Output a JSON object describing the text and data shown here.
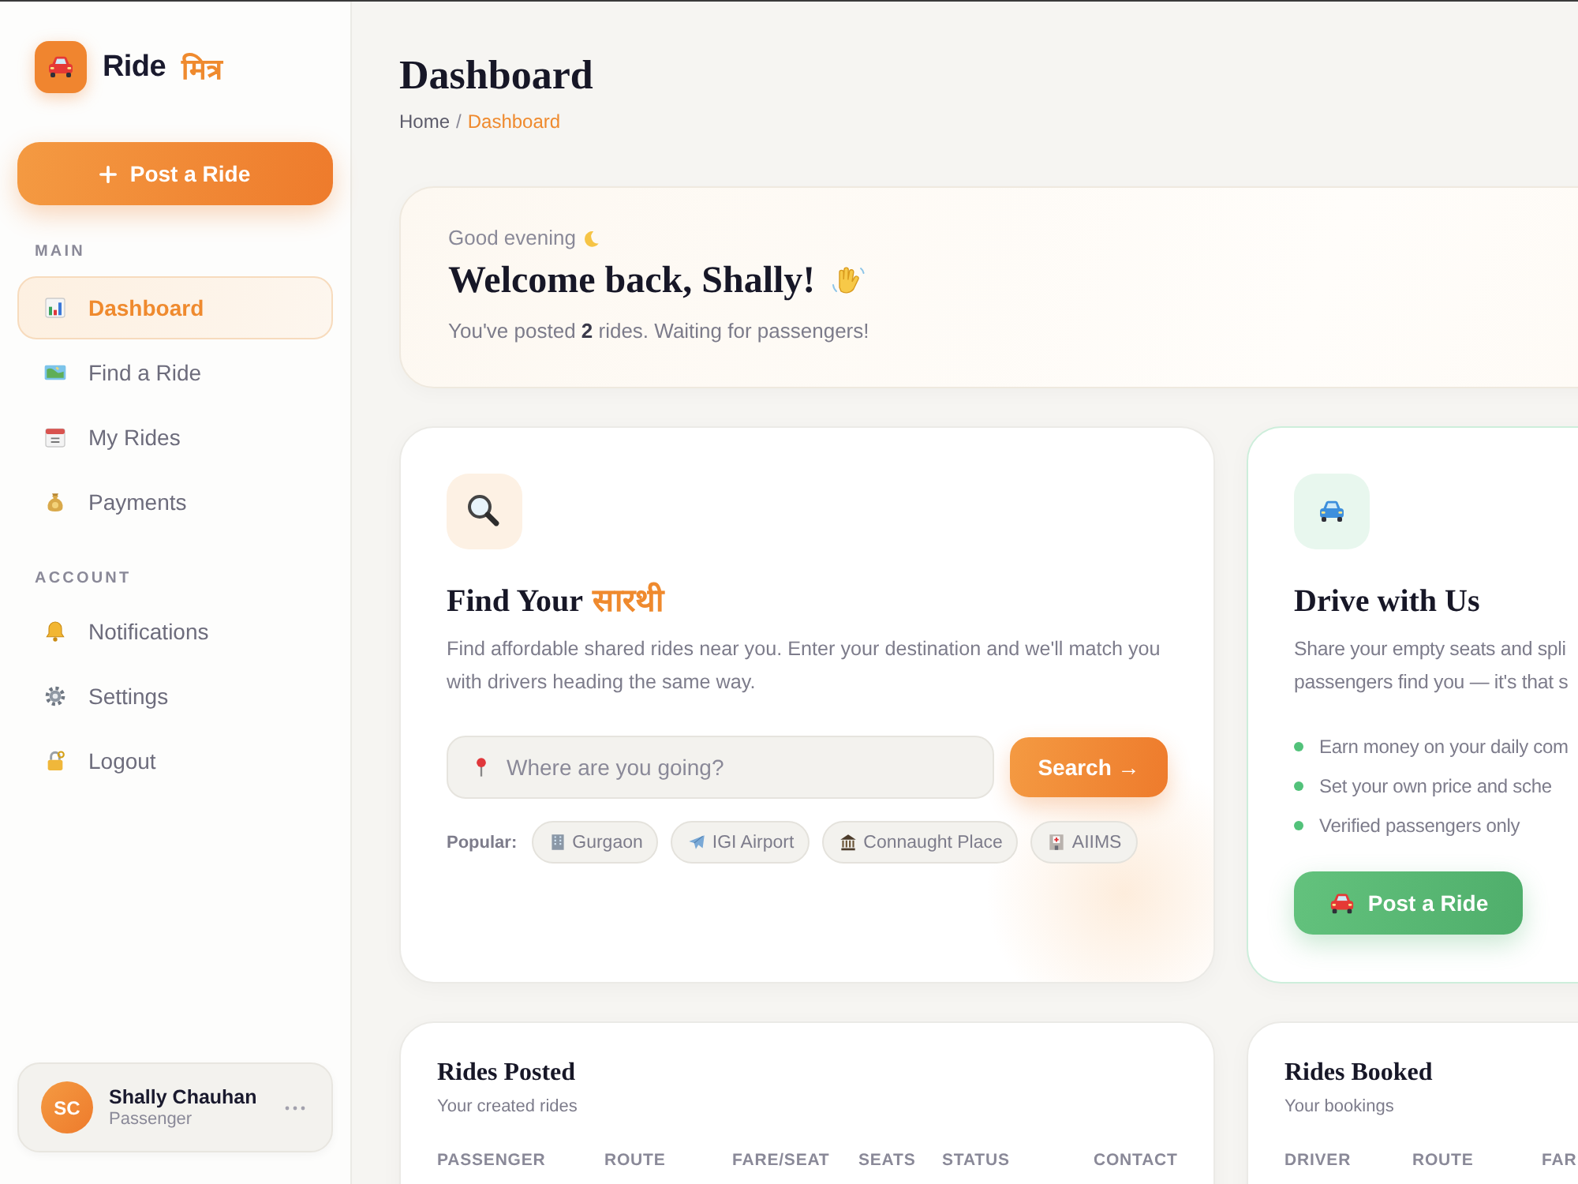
{
  "sidebar": {
    "logo": {
      "text": "Ride",
      "accent": "मित्र"
    },
    "post_button": "Post a Ride",
    "sections": [
      {
        "heading": "MAIN",
        "items": [
          {
            "label": "Dashboard",
            "selected": true
          },
          {
            "label": "Find a Ride",
            "selected": false
          },
          {
            "label": "My Rides",
            "selected": false
          },
          {
            "label": "Payments",
            "selected": false
          }
        ]
      },
      {
        "heading": "ACCOUNT",
        "items": [
          {
            "label": "Notifications",
            "selected": false
          },
          {
            "label": "Settings",
            "selected": false
          },
          {
            "label": "Logout",
            "selected": false
          }
        ]
      }
    ],
    "user": {
      "initials": "SC",
      "name": "Shally Chauhan",
      "role": "Passenger"
    }
  },
  "header": {
    "title": "Dashboard",
    "breadcrumb_separator": "/",
    "breadcrumb": [
      {
        "label": "Home",
        "current": false
      },
      {
        "label": "Dashboard",
        "current": true
      }
    ]
  },
  "welcome": {
    "greeting": "Good evening",
    "title": "Welcome back, Shally!",
    "message": "You've posted **2** rides. Waiting for passengers!"
  },
  "find_card": {
    "title": "Find Your",
    "title_accent": "सारथी",
    "description": "Find affordable shared rides near you. Enter your destination and we'll match you with drivers heading the same way.",
    "search": {
      "placeholder": "Where are you going?",
      "button": "Search →"
    },
    "popular_label": "Popular:",
    "popular": [
      "Gurgaon",
      "IGI Airport",
      "Connaught Place",
      "AIIMS"
    ]
  },
  "drive_card": {
    "title": "Drive with Us",
    "description_lines": [
      "Share your empty seats and spli",
      "passengers find you — it's that s"
    ],
    "features": [
      "Earn money on your daily com",
      "Set your own price and sche",
      "Verified passengers only"
    ],
    "button": "Post a Ride"
  },
  "tables": [
    {
      "title": "Rides Posted",
      "subtitle": "Your created rides",
      "columns": [
        "PASSENGER",
        "ROUTE",
        "FARE/SEAT",
        "SEATS",
        "STATUS",
        "CONTACT"
      ]
    },
    {
      "title": "Rides Booked",
      "subtitle": "Your bookings",
      "columns": [
        "DRIVER",
        "ROUTE",
        "FAR"
      ]
    }
  ]
}
